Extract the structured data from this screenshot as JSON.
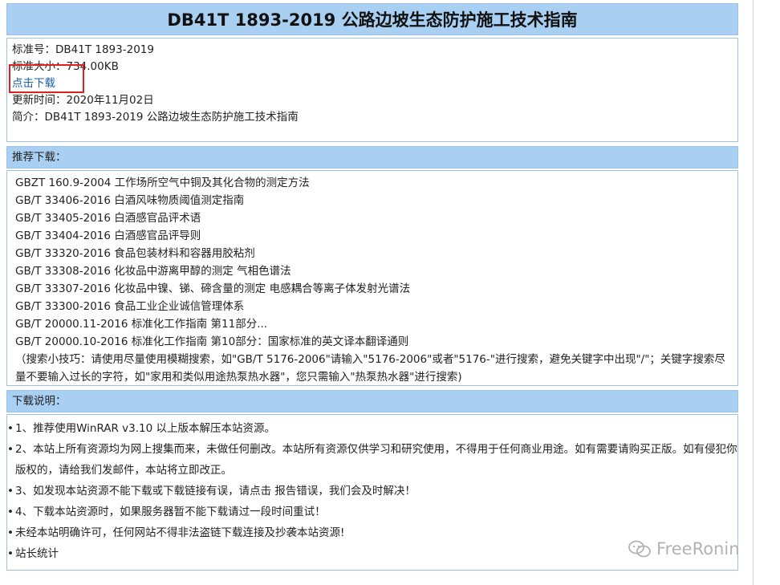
{
  "title": "DB41T 1893-2019 公路边坡生态防护施工技术指南",
  "info": {
    "standard_no": "标准号：DB41T 1893-2019",
    "size": "标准大小：734.00KB",
    "download_link": "点击下载",
    "updated": "更新时间：2020年11月02日",
    "summary": "简介：DB41T 1893-2019 公路边坡生态防护施工技术指南"
  },
  "recommend": {
    "heading": "推荐下载：",
    "items": [
      "GBZT 160.9-2004 工作场所空气中铜及其化合物的测定方法",
      "GB/T 33406-2016 白酒风味物质阈值测定指南",
      "GB/T 33405-2016 白酒感官品评术语",
      "GB/T 33404-2016 白酒感官品评导则",
      "GB/T 33320-2016 食品包装材料和容器用胶粘剂",
      "GB/T 33308-2016 化妆品中游离甲醇的测定 气相色谱法",
      "GB/T 33307-2016 化妆品中镍、锑、碲含量的测定 电感耦合等离子体发射光谱法",
      "GB/T 33300-2016 食品工业企业诚信管理体系",
      "GB/T 20000.11-2016 标准化工作指南 第11部分...",
      "GB/T 20000.10-2016 标准化工作指南 第10部分：国家标准的英文译本翻译通则"
    ],
    "tip": "（搜索小技巧：请使用尽量使用模糊搜索，如\"GB/T 5176-2006\"请输入\"5176-2006\"或者\"5176-\"进行搜索，避免关键字中出现\"/\"；关键字搜索尽量不要输入过长的字符，如\"家用和类似用途热泵热水器\"，您只需输入\"热泵热水器\"进行搜索)"
  },
  "notes": {
    "heading": "下载说明：",
    "items": [
      "1、推荐使用WinRAR v3.10 以上版本解压本站资源。",
      "2、本站上所有资源均为网上搜集而来，未做任何删改。本站所有资源仅供学习和研究使用，不得用于任何商业用途。如有需要请购买正版。如有侵犯你版权的，请给我们发邮件，本站将立即改正。",
      "3、如发现本站资源不能下载或下载链接有误，请点击 报告错误，我们会及时解决！",
      "4、下载本站资源时，如果服务器暂不能下载请过一段时间重试！",
      "未经本站明确许可，任何网站不得非法盗链下载连接及抄袭本站资源!",
      "站长统计"
    ]
  },
  "watermark": "FreeRonin",
  "colors": {
    "header_bg": "#a9cff2",
    "border": "#9cc2e5",
    "link": "#1a5fb4",
    "highlight": "#e0201f"
  }
}
